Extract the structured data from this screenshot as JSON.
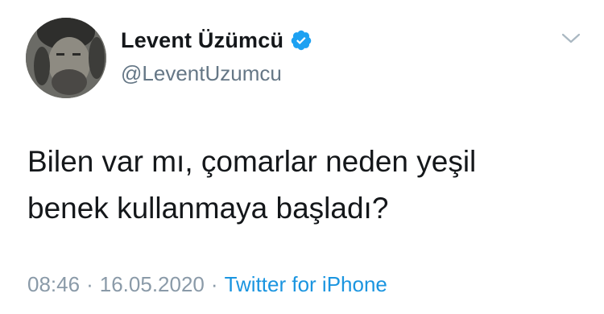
{
  "author": {
    "display_name": "Levent Üzümcü",
    "handle": "@LeventUzumcu",
    "verified": true,
    "verified_color": "#1da1f2"
  },
  "tweet": {
    "text_line_1": "Bilen var mı, çomarlar neden yeşil",
    "text_line_2": "benek kullanmaya başladı?"
  },
  "meta": {
    "time": "08:46",
    "separator": "·",
    "date": "16.05.2020",
    "source": "Twitter for iPhone",
    "source_color": "#1b95e0"
  },
  "icons": {
    "menu": "chevron-down-icon",
    "badge": "verified-badge-icon"
  }
}
